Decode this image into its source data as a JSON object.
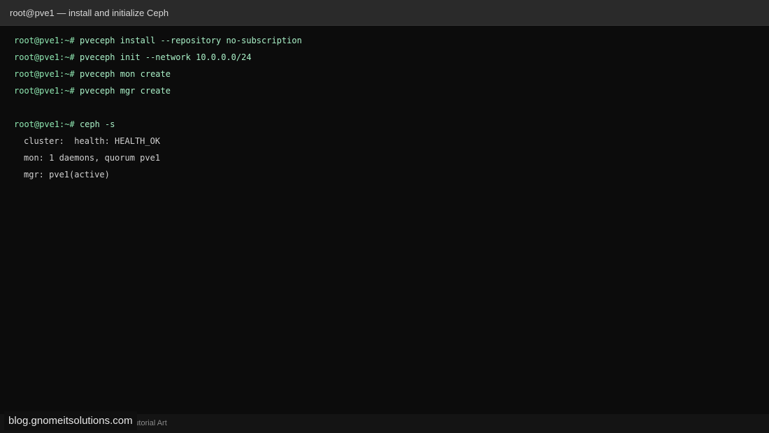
{
  "window": {
    "title": "root@pve1 — install and initialize Ceph"
  },
  "terminal": {
    "prompt": "root@pve1:~#",
    "commands": [
      "pveceph install --repository no-subscription",
      "pveceph init --network 10.0.0.0/24",
      "pveceph mon create",
      "pveceph mgr create",
      "ceph -s"
    ],
    "output": [
      "cluster:  health: HEALTH_OK",
      "mon: 1 daemons, quorum pve1",
      "mgr: pve1(active)"
    ]
  },
  "statusbar": {
    "text": "Tutorial Art"
  },
  "watermark": {
    "text": "blog.gnomeitsolutions.com"
  }
}
